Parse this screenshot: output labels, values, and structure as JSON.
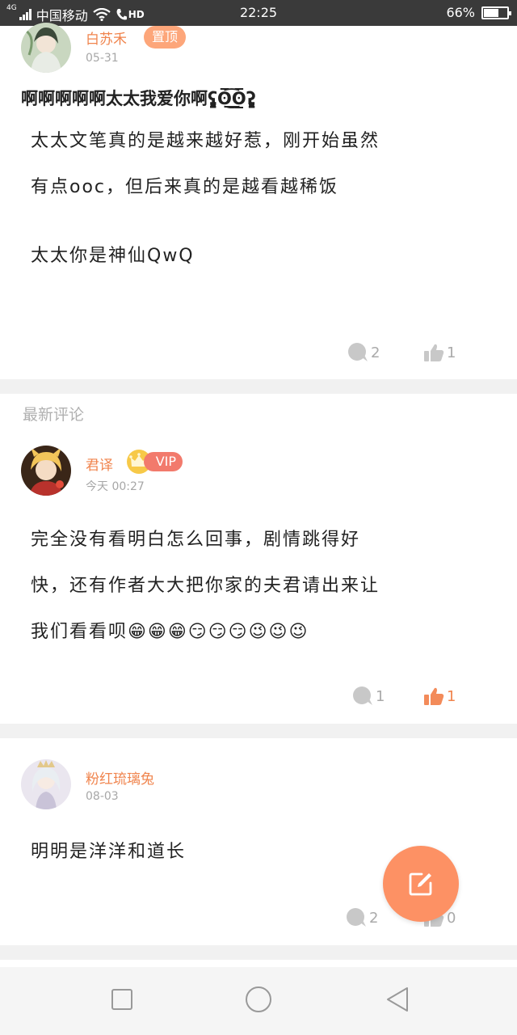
{
  "status_bar": {
    "network_label": "4G",
    "carrier": "中国移动",
    "hd_label": "HD",
    "time": "22:25",
    "battery_percent": "66%",
    "battery_level": 0.66
  },
  "post": {
    "author": "白苏禾",
    "pinned_label": "置顶",
    "date": "05-31",
    "title": "啊啊啊啊啊太太我爱你啊ʕ̡̢̡ʘ̅͟͜͡ʘ̲̅ʔ̢̡̢",
    "body_lines": [
      "太太文笔真的是越来越好惹，刚开始虽然",
      "有点ooc，但后来真的是越看越稀饭",
      "",
      "太太你是神仙QwQ"
    ],
    "comment_count": "2",
    "like_count": "1"
  },
  "section_label": "最新评论",
  "comments": [
    {
      "author": "君译",
      "vip_label": "VIP",
      "date": "今天 00:27",
      "body_lines": [
        "完全没有看明白怎么回事，剧情跳得好",
        "快，还有作者大大把你家的夫君请出来让",
        "我们看看呗😁😁😁😏😏😏😉😉😉"
      ],
      "comment_count": "1",
      "like_count": "1",
      "liked": true
    },
    {
      "author": "粉红琉璃兔",
      "date": "08-03",
      "body_lines": [
        "明明是洋洋和道长"
      ],
      "comment_count": "2",
      "like_count": "0",
      "liked": false
    }
  ],
  "icons": {
    "comment": "comment-bubble-icon",
    "like": "thumbs-up-icon",
    "compose": "compose-icon",
    "nav_recent": "square-icon",
    "nav_home": "circle-icon",
    "nav_back": "triangle-back-icon"
  },
  "colors": {
    "accent": "#f0844d",
    "fab": "#fd9164",
    "pin_badge": "#fda67a",
    "vip_badge": "#f27a6c",
    "status_bar": "#3a3a3a"
  }
}
